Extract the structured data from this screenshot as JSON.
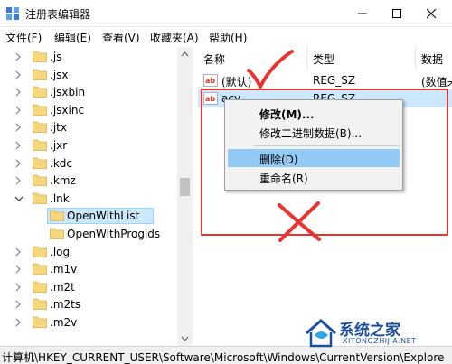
{
  "window": {
    "title": "注册表编辑器",
    "icon": "regedit-icon"
  },
  "menu": [
    "文件(F)",
    "编辑(E)",
    "查看(V)",
    "收藏夹(A)",
    "帮助(H)"
  ],
  "tree": {
    "items": [
      {
        "label": ".js",
        "expander": "collapsed"
      },
      {
        "label": ".jsx",
        "expander": "collapsed"
      },
      {
        "label": ".jsxbin",
        "expander": "collapsed"
      },
      {
        "label": ".jsxinc",
        "expander": "collapsed"
      },
      {
        "label": ".jtx",
        "expander": "collapsed"
      },
      {
        "label": ".jxr",
        "expander": "collapsed"
      },
      {
        "label": ".kdc",
        "expander": "collapsed"
      },
      {
        "label": ".kmz",
        "expander": "collapsed"
      },
      {
        "label": ".lnk",
        "expander": "expanded"
      },
      {
        "label": "OpenWithList",
        "expander": "none",
        "selected": true
      },
      {
        "label": "OpenWithProgids",
        "expander": "none"
      },
      {
        "label": ".log",
        "expander": "collapsed"
      },
      {
        "label": ".m1v",
        "expander": "collapsed"
      },
      {
        "label": ".m2t",
        "expander": "collapsed"
      },
      {
        "label": ".m2ts",
        "expander": "collapsed"
      },
      {
        "label": ".m2v",
        "expander": "collapsed"
      }
    ]
  },
  "list": {
    "columns": [
      "名称",
      "类型",
      "数据"
    ],
    "rows": [
      {
        "name": "(默认)",
        "type": "REG_SZ",
        "data": "(数值未"
      },
      {
        "name": "acv",
        "type": "REG_SZ",
        "data": "",
        "selected": true
      }
    ]
  },
  "context_menu": {
    "items": [
      {
        "label": "修改(M)...",
        "bold": true
      },
      {
        "label": "修改二进制数据(B)..."
      },
      {
        "label": "删除(D)",
        "hover": true
      },
      {
        "label": "重命名(R)"
      }
    ]
  },
  "status": {
    "path": "计算机\\HKEY_CURRENT_USER\\Software\\Microsoft\\Windows\\CurrentVersion\\Explore"
  },
  "watermark": {
    "name": "系统之家",
    "url": "XITONGZHIJIA.NET"
  },
  "colors": {
    "annotation_red": "#e8332f",
    "selection": "#cce8ff",
    "menu_hover": "#91c9f7",
    "folder": "#f5d77e"
  }
}
